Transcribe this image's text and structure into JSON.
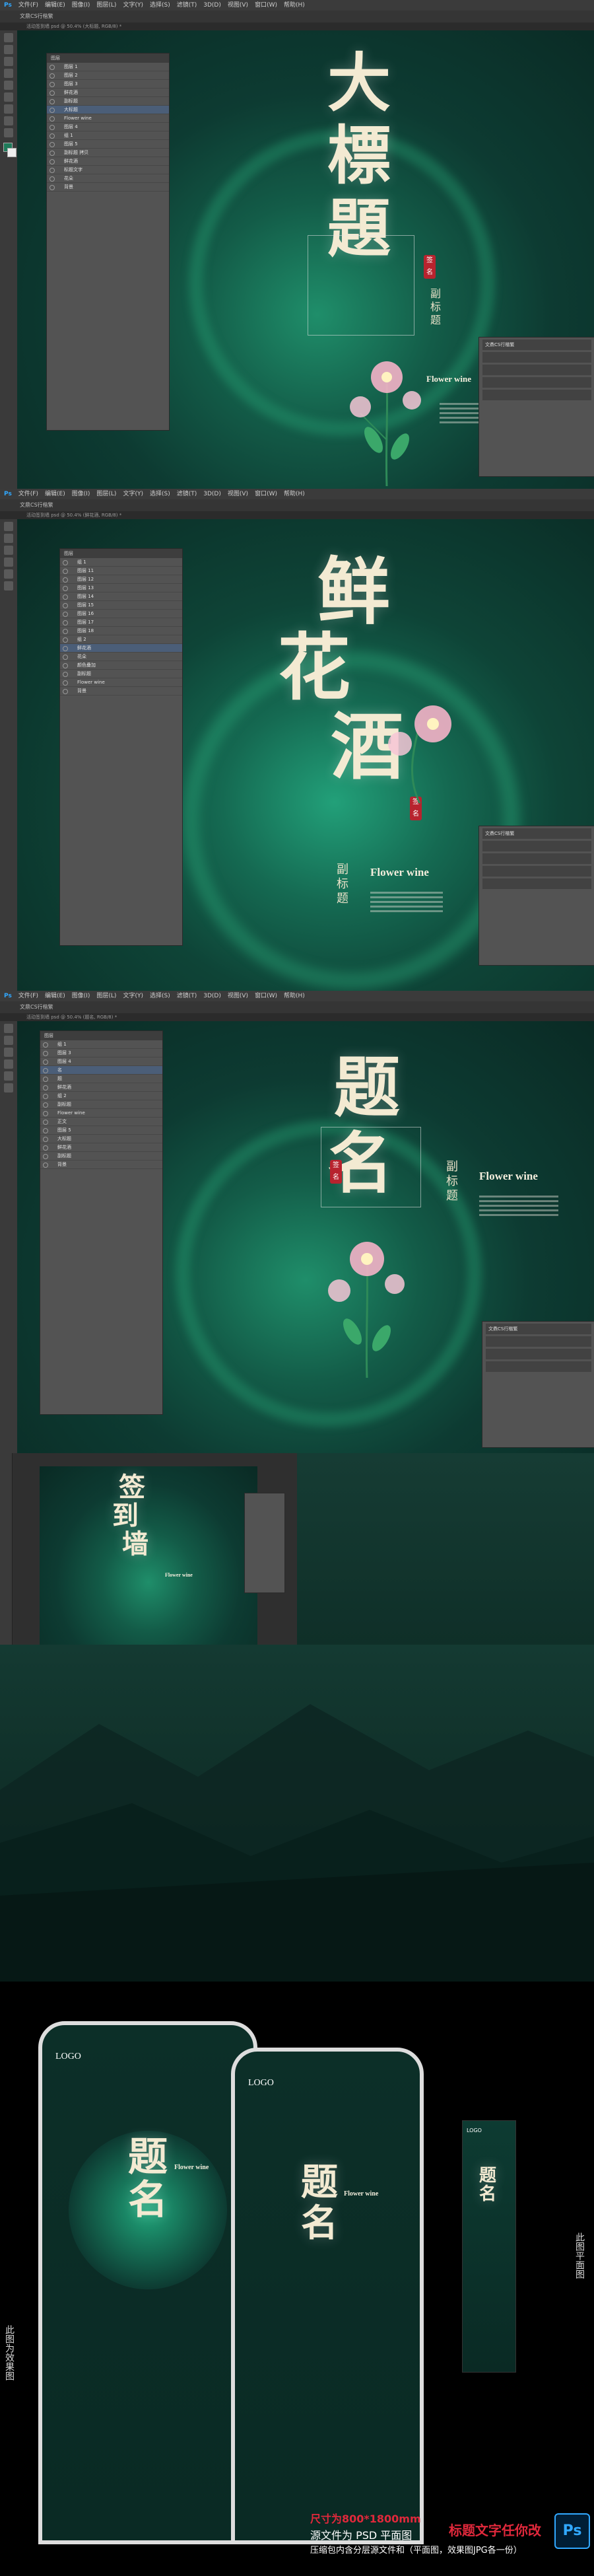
{
  "app": {
    "name": "Ps",
    "menu": [
      "文件(F)",
      "编辑(E)",
      "图像(I)",
      "图层(L)",
      "文字(Y)",
      "选择(S)",
      "滤镜(T)",
      "3D(D)",
      "视图(V)",
      "窗口(W)",
      "帮助(H)"
    ]
  },
  "screens": [
    {
      "title_chars": [
        "大",
        "標",
        "題"
      ],
      "seal": "签名",
      "subtitle": "副标题",
      "english": "Flower wine",
      "font_label": "文鼎CS行楷繁",
      "doc_tab": "活动签到墙 psd @ 50.4% (大标题, RGB/8) *",
      "layers": [
        "图层 1",
        "图层 2",
        "图层 3",
        "鲜花酒",
        "副标题",
        "大标题",
        "Flower wine",
        "图层 4",
        "组 1",
        "图层 5",
        "副标题 拷贝",
        "鲜花酒",
        "标题文字",
        "花朵",
        "背景"
      ]
    },
    {
      "title_chars": [
        "鲜",
        "花",
        "酒"
      ],
      "seal": "签名",
      "subtitle": "副标题",
      "english": "Flower wine",
      "font_label": "文鼎CS行楷繁",
      "doc_tab": "活动签到墙 psd @ 50.4% (鲜花酒, RGB/8) *",
      "layers": [
        "组 1",
        "图层 11",
        "图层 12",
        "图层 13",
        "图层 14",
        "图层 15",
        "图层 16",
        "图层 17",
        "图层 18",
        "组 2",
        "鲜花酒",
        "花朵",
        "颜色叠加",
        "副标题",
        "Flower wine",
        "背景"
      ]
    },
    {
      "title_chars": [
        "题",
        "名"
      ],
      "seal": "签名",
      "subtitle": "副标题",
      "english": "Flower wine",
      "font_label": "文鼎CS行楷繁",
      "doc_tab": "活动签到墙 psd @ 50.4% (题名, RGB/8) *",
      "layers": [
        "组 1",
        "图层 3",
        "图层 4",
        "名",
        "题",
        "鲜花酒",
        "组 2",
        "副标题",
        "Flower wine",
        "正文",
        "图层 5",
        "大标题",
        "鲜花酒",
        "副标题",
        "背景"
      ]
    }
  ],
  "small_screen": {
    "title_chars": [
      "签",
      "到",
      "墙"
    ],
    "english": "Flower wine"
  },
  "standee": {
    "logo": "LOGO",
    "title_chars": [
      "题",
      "名"
    ],
    "english": "Flower wine",
    "side_left": "此图为效果图",
    "side_right": "此图平面图",
    "notes": [
      {
        "text": "尺寸为800*1800mm",
        "color": "#e0283b"
      },
      {
        "text": "源文件为 PSD 平面图",
        "color": "#ffffff"
      },
      {
        "text": "压缩包内含分层源文件和（平面图，效果图JPG各一份）",
        "color": "#ffffff"
      }
    ],
    "note_red_big": "标题文字任你改",
    "ps_badge": "Ps"
  },
  "colors": {
    "bg_green": "#0d3b32",
    "glow": "#1fa57a",
    "ps_blue": "#31a8ff",
    "seal_red": "#b8232e"
  }
}
